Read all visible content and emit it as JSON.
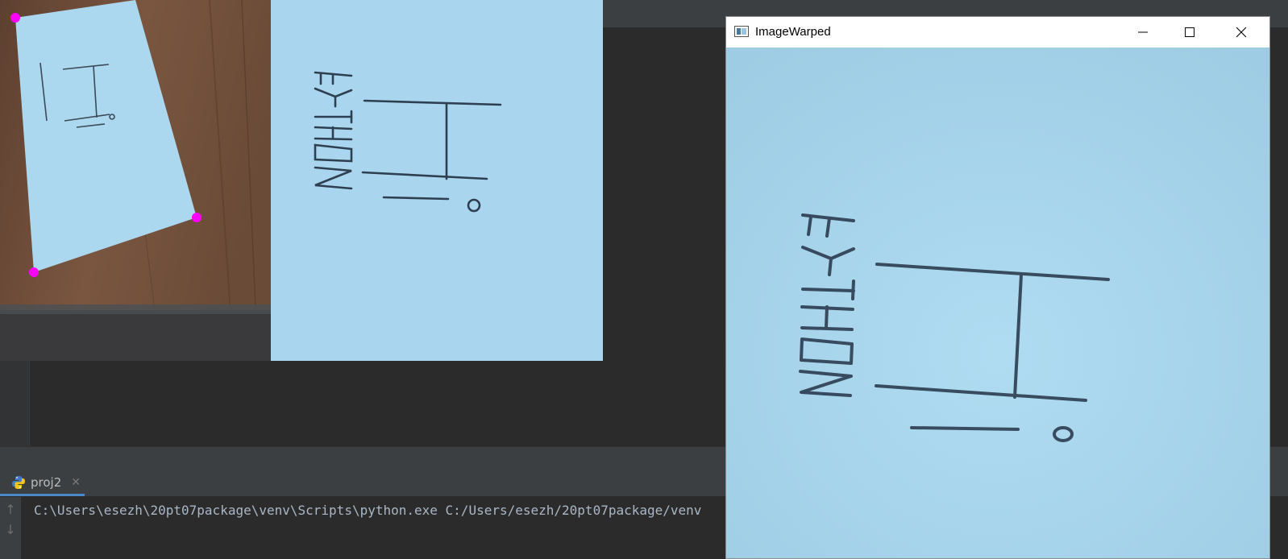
{
  "colors": {
    "ide_bg": "#2b2b2b",
    "paper": "#acd8ef",
    "marker": "#ff00ff",
    "ink": "#2a3a4a",
    "table_wood": "#6b4a35"
  },
  "run_panel": {
    "tab_label": "proj2",
    "tab_icon": "python-icon",
    "console_line": "C:\\Users\\esezh\\20pt07package\\venv\\Scripts\\python.exe C:/Users/esezh/20pt07package/venv"
  },
  "image_window": {
    "title": "ImageWarped",
    "controls": [
      "minimize-icon",
      "maximize-icon",
      "close-icon"
    ]
  },
  "paper_text": {
    "word": "PYTHON",
    "greeting": "Hi"
  }
}
